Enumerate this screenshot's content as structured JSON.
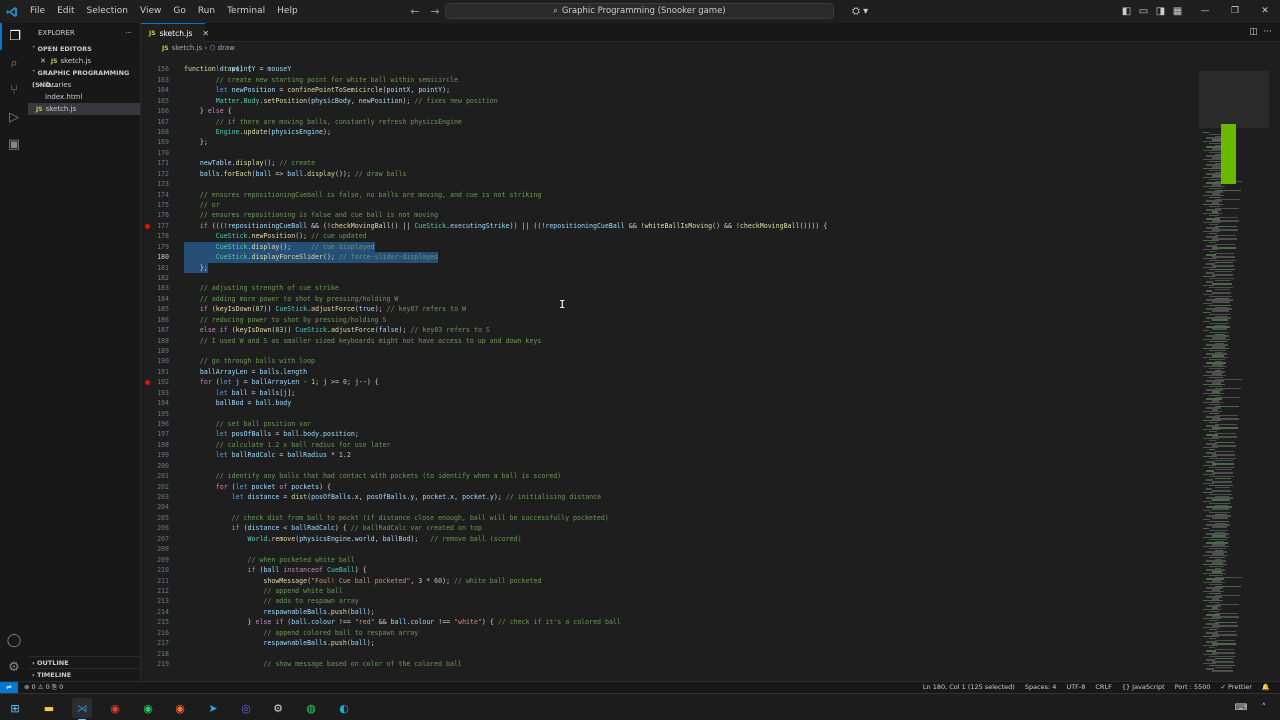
{
  "menu": [
    "File",
    "Edit",
    "Selection",
    "View",
    "Go",
    "Run",
    "Terminal",
    "Help"
  ],
  "search": {
    "text": "Graphic Programming (Snooker game)"
  },
  "sidebar": {
    "title": "EXPLORER",
    "open_editors": "OPEN EDITORS",
    "open_file": "sketch.js",
    "project": "GRAPHIC PROGRAMMING (SNO...",
    "items": [
      "libraries",
      "index.html",
      "sketch.js"
    ],
    "outline": "OUTLINE",
    "timeline": "TIMELINE"
  },
  "tab": {
    "label": "sketch.js"
  },
  "breadcrumbs": {
    "file": "sketch.js",
    "symbol": "draw"
  },
  "code": {
    "function_header": "function draw() {",
    "lines": [
      {
        "n": "156",
        "t": "        let pointY = mouseY"
      },
      {
        "n": "163",
        "t": "        // create new starting point for white ball within semicircle"
      },
      {
        "n": "164",
        "t": "        let newPosition = confinePointToSemicircle(pointX, pointY);"
      },
      {
        "n": "165",
        "t": "        Matter.Body.setPosition(physicBody, newPosition); // fixes new position"
      },
      {
        "n": "166",
        "t": "    } else {"
      },
      {
        "n": "167",
        "t": "        // if there are moving balls, constantly refresh physicsEngine"
      },
      {
        "n": "168",
        "t": "        Engine.update(physicsEngine);"
      },
      {
        "n": "169",
        "t": "    };"
      },
      {
        "n": "170",
        "t": ""
      },
      {
        "n": "171",
        "t": "    newTable.display(); // create"
      },
      {
        "n": "172",
        "t": "    balls.forEach(ball => ball.display()); // draw balls"
      },
      {
        "n": "173",
        "t": ""
      },
      {
        "n": "174",
        "t": "    // ensures repositioningCueball is false, no balls are moving, and cue is not striking"
      },
      {
        "n": "175",
        "t": "    // or"
      },
      {
        "n": "176",
        "t": "    // ensures repositioning is false and cue ball is not moving"
      },
      {
        "n": "177",
        "t": "    if (((!repositioningCueBall && (!checkMovingBall() || CueStick.executingStrike)) || ((!repositioningCueBall && !whiteBallIsMoving() && !checkMovingBall()))) {"
      },
      {
        "n": "178",
        "t": "        CueStick.newPosition(); // cue updated"
      },
      {
        "n": "179",
        "t": "        CueStick.display();     // cue displayed"
      },
      {
        "n": "180",
        "t": "        CueStick.displayForceSlider(); // force-slider-displayed"
      },
      {
        "n": "181",
        "t": "    };"
      },
      {
        "n": "182",
        "t": ""
      },
      {
        "n": "183",
        "t": "    // adjusting strength of cue strike"
      },
      {
        "n": "184",
        "t": "    // adding more power to shot by pressing/holding W"
      },
      {
        "n": "185",
        "t": "    if (keyIsDown(87)) CueStick.adjustForce(true); // key87 refers to W"
      },
      {
        "n": "186",
        "t": "    // reducing power to shot by pressing/holding S"
      },
      {
        "n": "187",
        "t": "    else if (keyIsDown(83)) CueStick.adjustForce(false); // key83 refers to S"
      },
      {
        "n": "188",
        "t": "    // I used W and S as smaller sized keyboards might not have access to up and down keys"
      },
      {
        "n": "189",
        "t": ""
      },
      {
        "n": "190",
        "t": "    // go through balls with loop"
      },
      {
        "n": "191",
        "t": "    ballArrayLen = balls.length"
      },
      {
        "n": "192",
        "t": "    for (let j = ballArrayLen - 1; j >= 0; j--) {"
      },
      {
        "n": "193",
        "t": "        let ball = balls[j];"
      },
      {
        "n": "194",
        "t": "        ballBod = ball.body"
      },
      {
        "n": "195",
        "t": ""
      },
      {
        "n": "196",
        "t": "        // set ball position var"
      },
      {
        "n": "197",
        "t": "        let posOfBalls = ball.body.position;"
      },
      {
        "n": "198",
        "t": "        // calculate 1.2 x ball radius for use later"
      },
      {
        "n": "199",
        "t": "        let ballRadCalc = ballRadius * 1.2"
      },
      {
        "n": "200",
        "t": ""
      },
      {
        "n": "201",
        "t": "        // identify any balls that had contact with pockets (to identify when a ball is scored)"
      },
      {
        "n": "202",
        "t": "        for (let pocket of pockets) {"
      },
      {
        "n": "203",
        "t": "            let distance = dist(posOfBalls.x, posOfBalls.y, pocket.x, pocket.y); // initialising distance"
      },
      {
        "n": "204",
        "t": ""
      },
      {
        "n": "205",
        "t": "            // check dist from ball to pockt (if distance close enough, ball will be successfully pocketed)"
      },
      {
        "n": "206",
        "t": "            if (distance < ballRadCalc) { // ballRadCalc var created on top"
      },
      {
        "n": "207",
        "t": "                World.remove(physicsEngine.world, ballBod);   // remove ball (scored)"
      },
      {
        "n": "208",
        "t": ""
      },
      {
        "n": "209",
        "t": "                // when pocketed white ball"
      },
      {
        "n": "210",
        "t": "                if (ball instanceof CueBall) {"
      },
      {
        "n": "211",
        "t": "                    showMessage(\"Foul! Cue ball pocketed\", 3 * 60); // white ball pocketed"
      },
      {
        "n": "212",
        "t": "                    // append white ball"
      },
      {
        "n": "213",
        "t": "                    // adds to respawn array"
      },
      {
        "n": "214",
        "t": "                    respawnableBalls.push(ball);"
      },
      {
        "n": "215",
        "t": "                } else if (ball.colour !== \"red\" && ball.colour !== \"white\") { // check if it's a colored ball"
      },
      {
        "n": "216",
        "t": "                    // append colored ball to respawn array"
      },
      {
        "n": "217",
        "t": "                    respawnableBalls.push(ball);"
      },
      {
        "n": "218",
        "t": ""
      },
      {
        "n": "219",
        "t": "                    // show message based on color of the colored ball"
      }
    ]
  },
  "status": {
    "left": "⊗ 0 ⚠ 0   ⎘ 0",
    "position": "Ln 180, Col 1 (125 selected)",
    "spaces": "Spaces: 4",
    "encoding": "UTF-8",
    "eol": "CRLF",
    "language": "{} JavaScript",
    "port": "Port : 5500",
    "prettier": "✓ Prettier"
  },
  "colors": {
    "accent": "#0078d4",
    "selection": "#264f78",
    "breakpoint": "#e51400"
  }
}
